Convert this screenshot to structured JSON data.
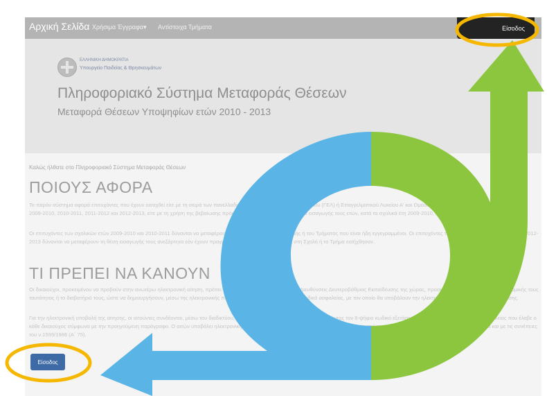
{
  "navbar": {
    "brand": "Αρχική Σελίδα",
    "items": [
      "Χρήσιμα Έγγραφα▾",
      "Αντίστοιχα Τμήματα"
    ],
    "login": "Είσοδος"
  },
  "header": {
    "ministry_line1": "ΕΛΛΗΝΙΚΗ ΔΗΜΟΚΡΑΤΙΑ",
    "ministry_line2": "Υπουργείο Παιδείας & Θρησκευμάτων",
    "title": "Πληροφοριακό Σύστημα Μεταφοράς Θέσεων",
    "subtitle": "Μεταφορά Θέσεων Υποψηφίων ετών 2010 - 2013"
  },
  "content": {
    "welcome": "Καλώς ήλθατε στο Πληροφοριακό Σύστημα Μεταφοράς Θέσεων",
    "heading1": "ΠΟΙΟΥΣ ΑΦΟΡΑ",
    "para1": "Το παρόν σύστημα αφορά επιτυχόντες που έχουν εισαχθεί είτε με τη σειρά των πανελλαδικών εξετάσεων του Γενικού Λυκείου (ΓΕΛ) ή Επαγγελματικού Λυκείου Α' και Ομάδας Β', Μαΐου – Ιουνίου των σχολικών ετών 2009-2010, 2010-2011, 2011-2012 και 2012-2013, είτε με τη χρήση της βεβαίωσης πρόσβασης των δύο προηγούμενων εισαγωγής τους ετών, κατά τα σχολικά έτη 2009-2010, 2010-2011, 2011-2012 και 2012-2013.",
    "para2": "Οι επιτυχόντες των σχολικών ετών 2009-2010 και 2010-2011 δύνανται να μεταφέρουν τη θέση εισαγωγής της Σχολής ή του Τμήματος που είναι ήδη εγγεγραμμένοι. Οι επιτυχόντες των σχολικών ετών 2011-2012 και 2012-2013 δύνανται να μεταφέρουν τη θέση εισαγωγής τους ανεξάρτητα εάν έχουν πραγματοποιήσει την εγγραφή τους στη Σχολή ή το Τμήμα εισήχθησαν.",
    "heading2": "ΤΙ ΠΡΕΠΕΙ ΝΑ ΚΑΝΟΥΝ",
    "para3": "Οι δικαιούχοι, προκειμένου να προβούν στην ανωτέρω ηλεκτρονική αίτηση, πρέπει να ταυτοποιηθούν σε μία από τις Διευθύνσεις Δευτεροβάθμιας Εκπαίδευσης της χώρας, προσκομίζοντας το δελτίο της Αστυνομικής τους ταυτότητας ή το διαβατήριό τους, ώστε να δημιουργήσουν, μέσω της ηλεκτρονικής πλατφόρμας τον προσωπικό τους κωδικό ασφαλείας, με τον οποίο θα υποβάλουν την ηλεκτρονική αίτηση μεταφοράς της θέσης.",
    "para4": "Για την ηλεκτρονική υποβολή της αίτησης, οι αιτούντες συνδέονται, μέσω του διαδικτύου, στο πληροφοριακό σύστημα χρησιμοποιώντας τον 8-ψήφιο κωδικό εξετάσεων και τον προσωπικό κωδικό ασφαλείας που έλαβε ο κάθε δικαιούχος σύμφωνα με την προηγούμενη παράγραφο. Ο αιτών υποβάλει ηλεκτρονική αίτηση μεταφοράς της θέσης εισαγωγής του η οποία επέχει και θέση υπεύθυνης δήλωσης, κατά την έννοια και με τις συνέπειες του ν.1599/1986 (Α΄ 75).",
    "login_button": "Είσοδος"
  },
  "annotations": {
    "highlight_color": "#f5b700",
    "blue_arrow_color": "#5ab4e5",
    "green_arrow_color": "#8cc63f"
  }
}
